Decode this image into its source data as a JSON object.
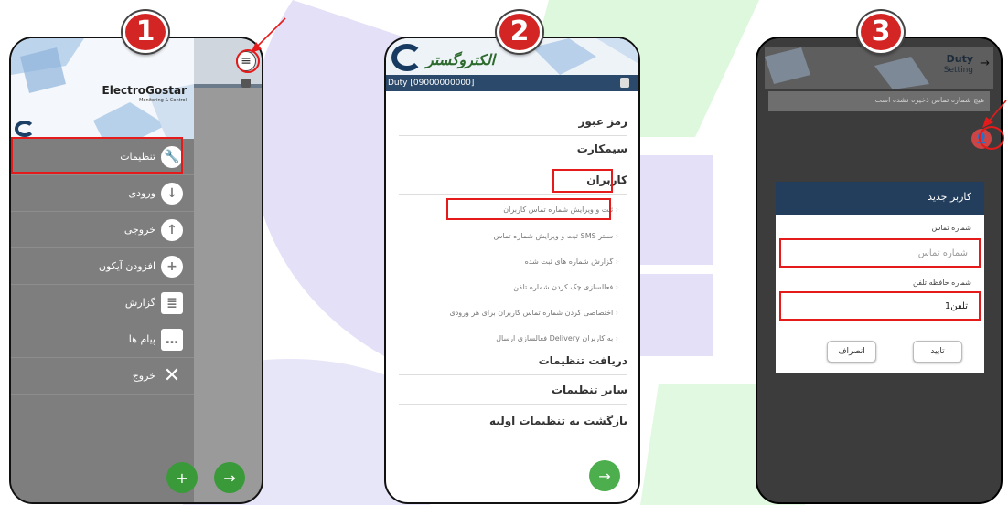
{
  "colors": {
    "accent_red": "#e51b1b",
    "green": "#3a9a3a",
    "navy": "#233e5c",
    "watermark_purple": "#c8c3ef",
    "watermark_green": "#c9f3c9"
  },
  "badges": [
    "1",
    "2",
    "3"
  ],
  "phone1": {
    "brand": "ElectroGostar",
    "brand_sub": "Monitoring & Control",
    "menu": [
      {
        "label": "تنظیمات",
        "icon": "wrench-icon"
      },
      {
        "label": "ورودی",
        "icon": "arrow-down-icon"
      },
      {
        "label": "خروجی",
        "icon": "arrow-up-icon"
      },
      {
        "label": "افزودن آیکون",
        "icon": "plus-icon"
      },
      {
        "label": "گزارش",
        "icon": "clipboard-icon"
      },
      {
        "label": "پیام ها",
        "icon": "chat-icon"
      },
      {
        "label": "خروج",
        "icon": "close-icon"
      }
    ],
    "fab_add": "+",
    "fab_next": "→"
  },
  "phone2": {
    "brand": "الکتروگستر",
    "bar_text": "Duty  [09000000000]",
    "sections": {
      "password": "رمز عبور",
      "simcard": "سیمکارت",
      "users": "کاربران",
      "receive_settings": "دریافت تنظیمات",
      "other_settings": "سایر تنظیمات",
      "reset": "بازگشت به تنظیمات اولیه"
    },
    "user_items": [
      "ثبت و ویرایش شماره تماس کاربران",
      "ثبت و ویرایش شماره تماس SMS سنتر",
      "گزارش شماره های ثبت شده",
      "فعالسازی چک کردن شماره تلفن",
      "اختصاصی کردن شماره تماس کاربران برای هر ورودی",
      "فعالسازی ارسال Delivery به کاربران"
    ],
    "fab_next": "→"
  },
  "phone3": {
    "duty": "Duty",
    "setting": "Setting",
    "alert": "هیچ شماره تماس ذخیره نشده است",
    "dialog": {
      "title": "کاربر جدید",
      "phone_label": "شماره تماس",
      "phone_placeholder": "شماره تماس",
      "memory_label": "شماره حافظه تلفن",
      "memory_value": "تلفن1",
      "confirm": "تایید",
      "cancel": "انصراف"
    }
  }
}
